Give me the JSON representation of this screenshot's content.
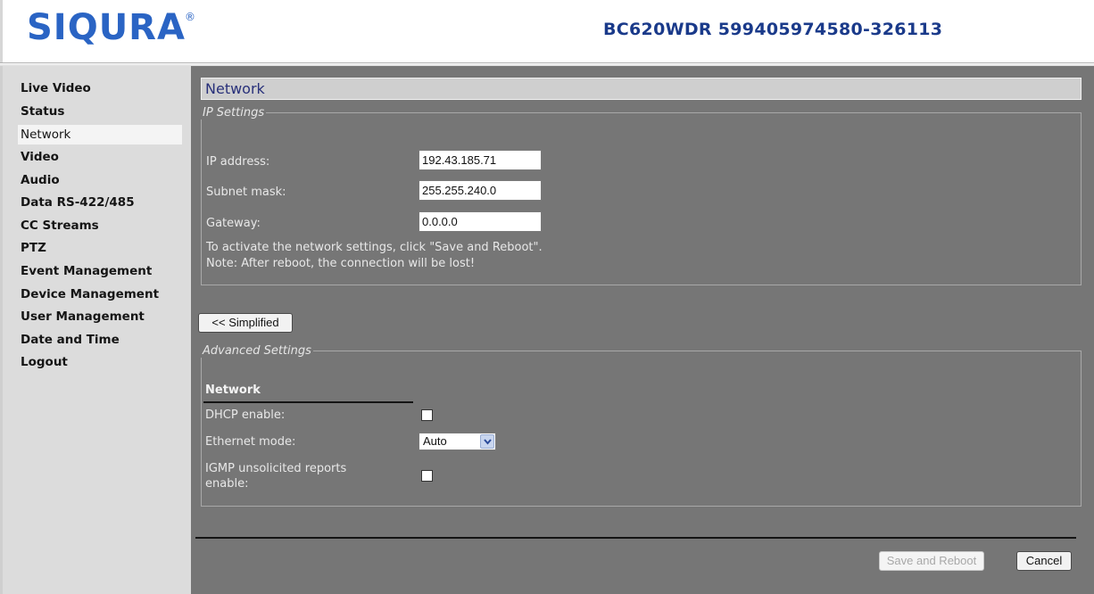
{
  "header": {
    "logo_text": "SIQURA®",
    "device_title": "BC620WDR 599405974580-326113"
  },
  "sidebar": {
    "items": [
      {
        "label": "Live Video"
      },
      {
        "label": "Status"
      },
      {
        "label": "Network",
        "active": true
      },
      {
        "label": "Video"
      },
      {
        "label": "Audio"
      },
      {
        "label": "Data RS-422/485"
      },
      {
        "label": "CC Streams"
      },
      {
        "label": "PTZ"
      },
      {
        "label": "Event Management"
      },
      {
        "label": "Device Management"
      },
      {
        "label": "User Management"
      },
      {
        "label": "Date and Time"
      },
      {
        "label": "Logout"
      }
    ]
  },
  "main": {
    "title": "Network",
    "ip_settings": {
      "legend": "IP Settings",
      "ip_label": "IP address:",
      "ip_value": "192.43.185.71",
      "subnet_label": "Subnet mask:",
      "subnet_value": "255.255.240.0",
      "gateway_label": "Gateway:",
      "gateway_value": "0.0.0.0",
      "note_line1": "To activate the network settings, click \"Save and Reboot\".",
      "note_line2": "Note: After reboot, the connection will be lost!"
    },
    "simplified_button": "<< Simplified",
    "advanced": {
      "legend": "Advanced Settings",
      "subheading": "Network",
      "dhcp_label": "DHCP enable:",
      "dhcp_checked": false,
      "ethernet_label": "Ethernet mode:",
      "ethernet_value": "Auto",
      "igmp_label_line1": "IGMP unsolicited reports",
      "igmp_label_line2": "enable:",
      "igmp_checked": false
    },
    "save_button": "Save and Reboot",
    "save_enabled": false,
    "cancel_button": "Cancel"
  },
  "colors": {
    "brand_blue": "#1a3a8a",
    "logo_blue": "#2a64c4",
    "main_bg": "#767676",
    "sidebar_bg": "#dcdcdc"
  },
  "icons": {
    "select_arrow": "chevron-down-icon"
  }
}
